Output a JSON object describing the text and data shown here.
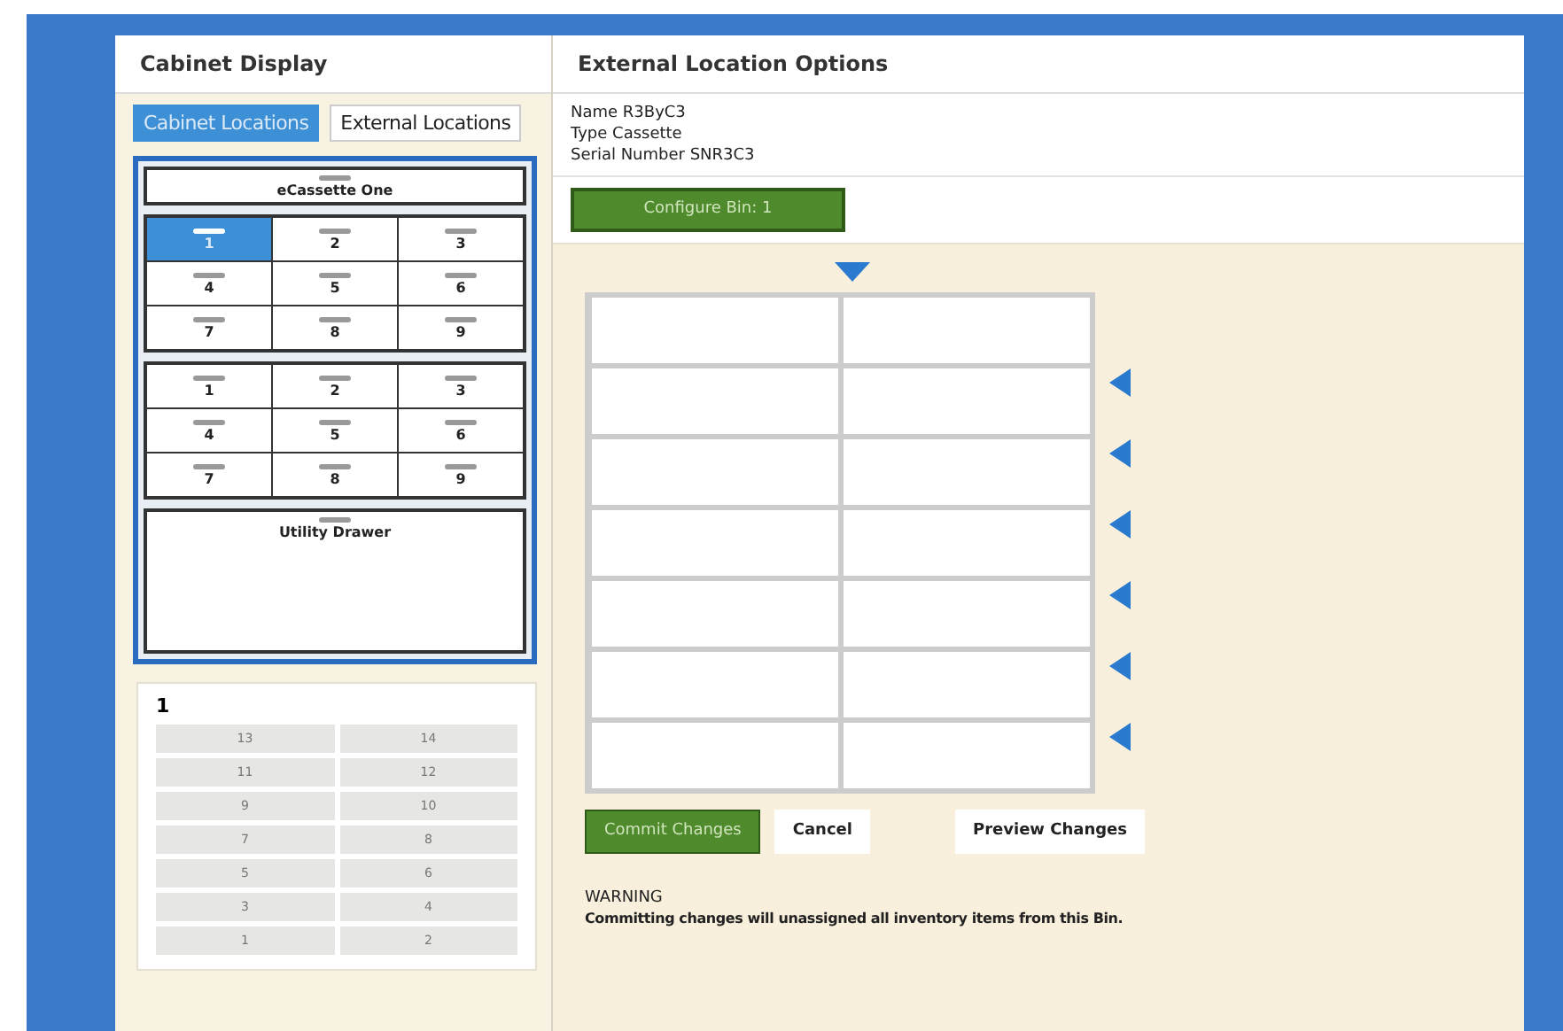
{
  "cabinet_display": {
    "title": "Cabinet Display",
    "tabs": [
      {
        "label": "Cabinet Locations",
        "selected": true
      },
      {
        "label": "External Locations",
        "selected": false
      }
    ],
    "top_slot": {
      "label": "eCassette One"
    },
    "drawers": [
      {
        "bins": [
          {
            "label": "1",
            "selected": true
          },
          {
            "label": "2",
            "selected": false
          },
          {
            "label": "3",
            "selected": false
          },
          {
            "label": "4",
            "selected": false
          },
          {
            "label": "5",
            "selected": false
          },
          {
            "label": "6",
            "selected": false
          },
          {
            "label": "7",
            "selected": false
          },
          {
            "label": "8",
            "selected": false
          },
          {
            "label": "9",
            "selected": false
          }
        ]
      },
      {
        "bins": [
          {
            "label": "1",
            "selected": false
          },
          {
            "label": "2",
            "selected": false
          },
          {
            "label": "3",
            "selected": false
          },
          {
            "label": "4",
            "selected": false
          },
          {
            "label": "5",
            "selected": false
          },
          {
            "label": "6",
            "selected": false
          },
          {
            "label": "7",
            "selected": false
          },
          {
            "label": "8",
            "selected": false
          },
          {
            "label": "9",
            "selected": false
          }
        ]
      }
    ],
    "utility_drawer": {
      "label": "Utility Drawer"
    },
    "bin_preview": {
      "title": "1",
      "rows": [
        [
          "13",
          "14"
        ],
        [
          "11",
          "12"
        ],
        [
          "9",
          "10"
        ],
        [
          "7",
          "8"
        ],
        [
          "5",
          "6"
        ],
        [
          "3",
          "4"
        ],
        [
          "1",
          "2"
        ]
      ]
    }
  },
  "external_location_options": {
    "title": "External Location Options",
    "info": [
      {
        "label": "Name",
        "value": "R3ByC3"
      },
      {
        "label": "Type",
        "value": "Cassette"
      },
      {
        "label": "Serial Number",
        "value": "SNR3C3"
      }
    ],
    "configure_button": "Configure Bin: 1",
    "bin_grid": {
      "rows": [
        {
          "divider_arrow": false
        },
        {
          "divider_arrow": true
        },
        {
          "divider_arrow": true
        },
        {
          "divider_arrow": true
        },
        {
          "divider_arrow": true
        },
        {
          "divider_arrow": true
        },
        {
          "divider_arrow": true
        }
      ]
    },
    "buttons": [
      {
        "label": "Commit Changes",
        "kind": "primary"
      },
      {
        "label": "Cancel",
        "kind": "plain"
      },
      {
        "label": "Preview Changes",
        "kind": "plain"
      }
    ],
    "warning": {
      "title": "WARNING",
      "text": "Committing changes will unassigned all inventory items from this Bin."
    }
  }
}
